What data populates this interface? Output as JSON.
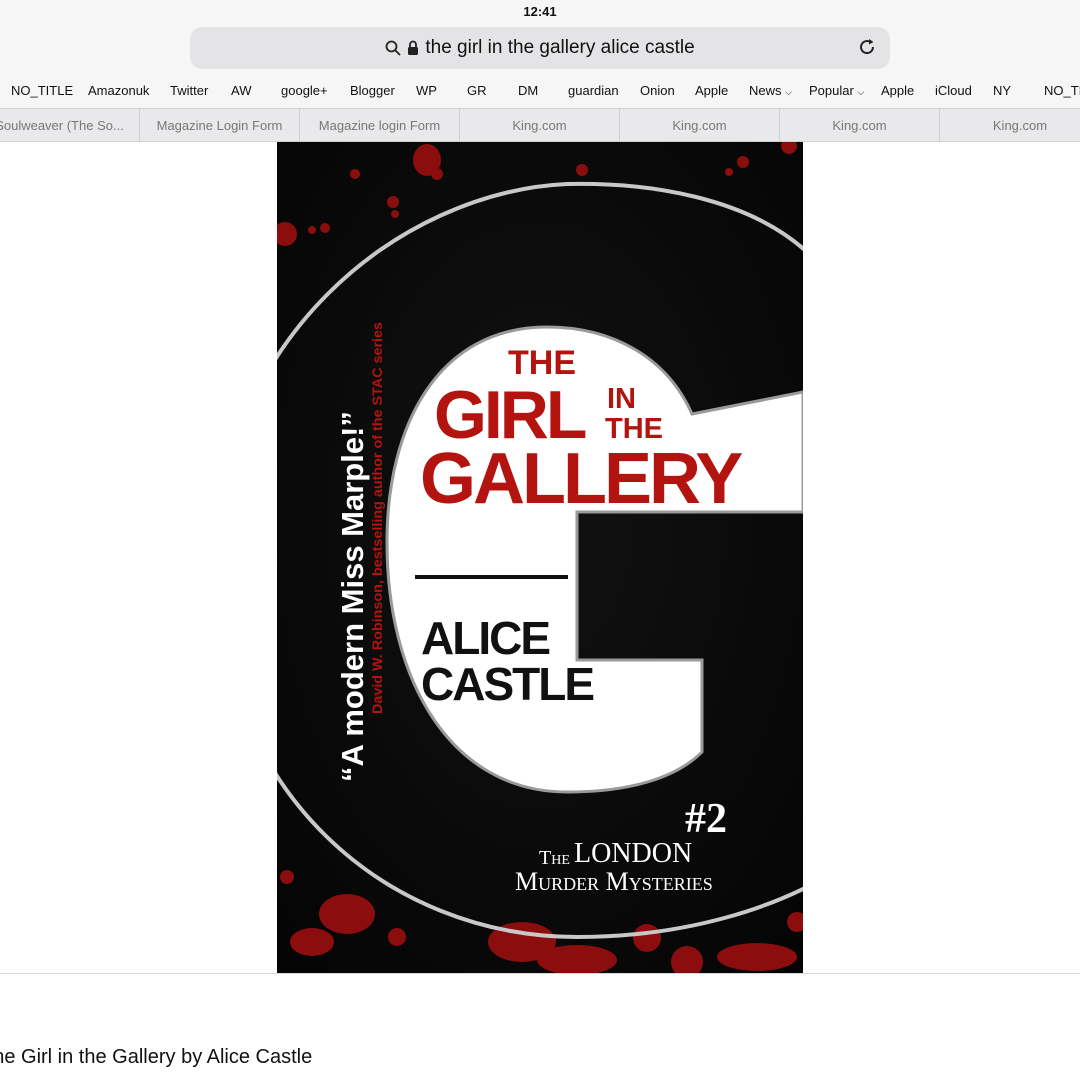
{
  "status": {
    "time": "12:41"
  },
  "address_bar": {
    "url_text": "the girl in the gallery alice castle"
  },
  "bookmarks": [
    "NO_TITLE",
    "Amazonuk",
    "Twitter",
    "AW",
    "google+",
    "Blogger",
    "WP",
    "GR",
    "DM",
    "guardian",
    "Onion",
    "Apple",
    "News",
    "Popular",
    "Apple",
    "iCloud",
    "NY",
    "NO_TITLE"
  ],
  "tabs": [
    "Soulweaver (The So...",
    "Magazine Login Form",
    "Magazine login Form",
    "King.com",
    "King.com",
    "King.com",
    "King.com"
  ],
  "cover": {
    "title_the": "THE",
    "title_girl": "GIRL",
    "title_in": "IN",
    "title_the2": "THE",
    "title_gallery": "GALLERY",
    "author_line1": "ALICE",
    "author_line2": "CASTLE",
    "quote": "“A modern Miss Marple!”",
    "quote_attrib": "David W. Robinson, bestselling author of the STAC series",
    "number": "#2",
    "series_the": "The",
    "series_london": "LONDON",
    "series_murder": "Murder Mysteries",
    "colors": {
      "background": "#070707",
      "accent_red": "#b3140f",
      "blood": "#8c0d0d"
    }
  },
  "caption": "The Girl in the Gallery by Alice Castle"
}
